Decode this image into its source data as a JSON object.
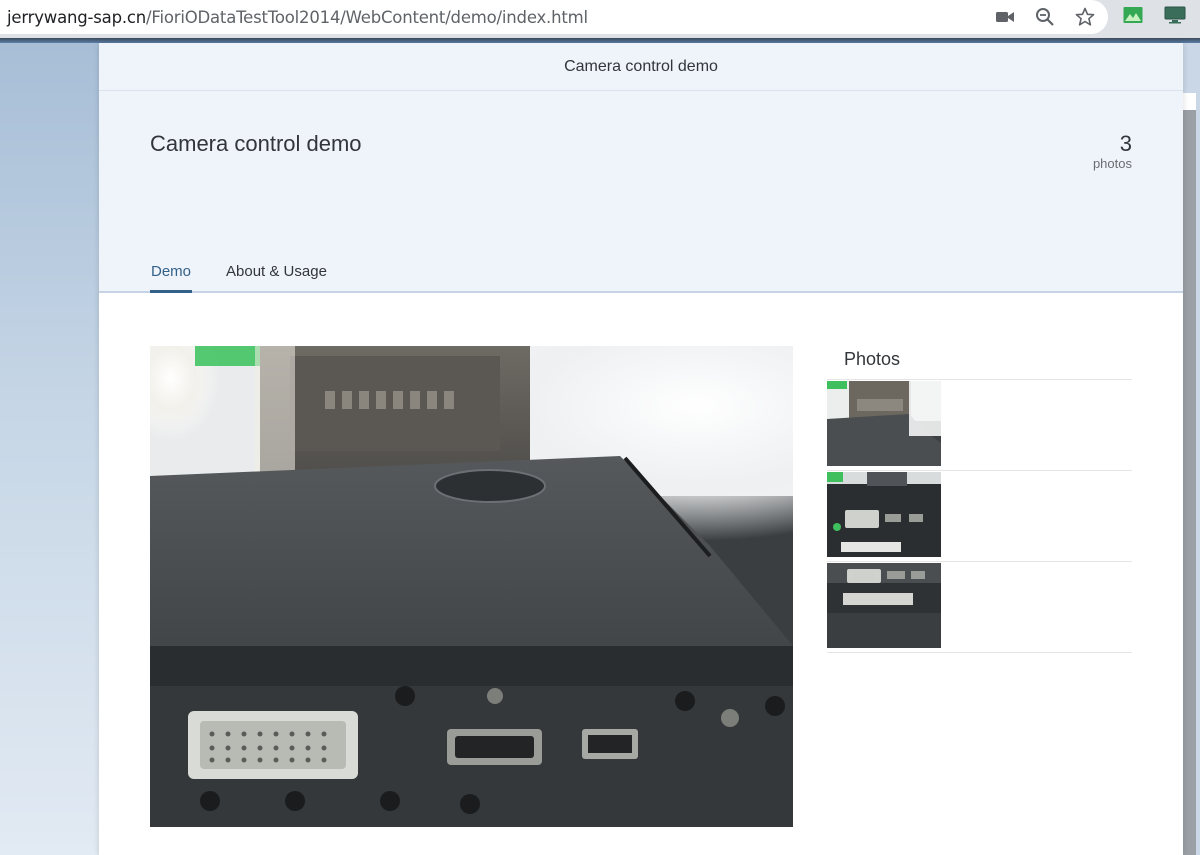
{
  "browser": {
    "url_host": "jerrywang-sap.cn",
    "url_path": "/FioriODataTestTool2014/WebContent/demo/index.html",
    "icons": [
      "camera-icon",
      "zoom-icon",
      "star-icon"
    ],
    "extensions": [
      "image-extension-icon",
      "monitor-extension-icon"
    ]
  },
  "shell": {
    "title": "Camera control demo"
  },
  "header": {
    "title": "Camera control demo",
    "number": "3",
    "number_unit": "photos"
  },
  "tabs": [
    {
      "label": "Demo",
      "selected": true
    },
    {
      "label": "About & Usage",
      "selected": false
    }
  ],
  "photos": {
    "title": "Photos",
    "count": 3
  },
  "colors": {
    "shell_bg": "#eff4fb",
    "tab_active": "#346187",
    "text": "#32363a"
  }
}
